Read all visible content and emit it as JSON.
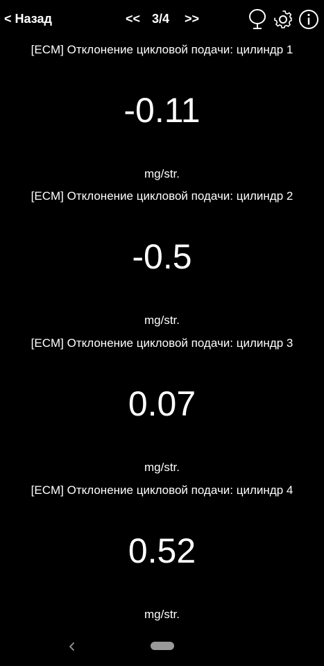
{
  "header": {
    "back_label": "< Назад",
    "pager": {
      "prev_label": "<<",
      "current": "3/4",
      "next_label": ">>"
    },
    "icons": [
      "tracker-icon",
      "gear-icon",
      "info-icon"
    ]
  },
  "parameters": [
    {
      "label": "[ECM] Отклонение цикловой подачи: цилиндр 1",
      "value": "-0.11",
      "unit": "mg/str."
    },
    {
      "label": "[ECM] Отклонение цикловой подачи: цилиндр 2",
      "value": "-0.5",
      "unit": "mg/str."
    },
    {
      "label": "[ECM] Отклонение цикловой подачи: цилиндр 3",
      "value": "0.07",
      "unit": "mg/str."
    },
    {
      "label": "[ECM] Отклонение цикловой подачи: цилиндр 4",
      "value": "0.52",
      "unit": "mg/str."
    }
  ],
  "colors": {
    "background": "#000000",
    "text": "#ffffff",
    "nav_pill": "#9a9a9a"
  }
}
